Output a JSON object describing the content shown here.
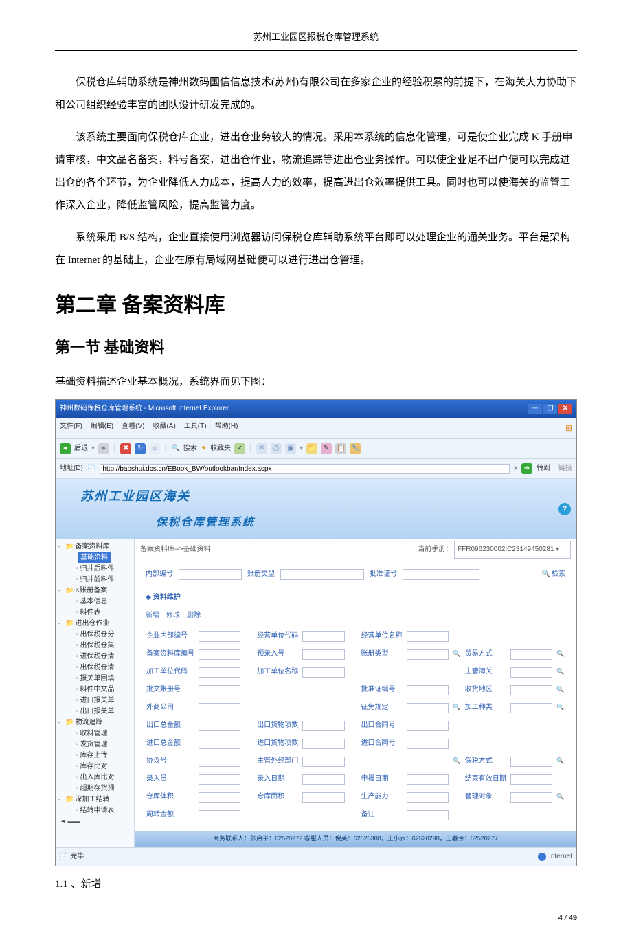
{
  "doc": {
    "page_header": "苏州工业园区报税仓库管理系统",
    "para1": "保税仓库辅助系统是神州数码国信信息技术(苏州)有限公司在多家企业的经验积累的前提下，在海关大力协助下和公司组织经验丰富的团队设计研发完成的。",
    "para2": "该系统主要面向保税仓库企业，进出仓业务较大的情况。采用本系统的信息化管理，可是使企业完成 K 手册申请审核，中文品名备案，料号备案，进出仓作业，物流追踪等进出仓业务操作。可以使企业足不出户便可以完成进出仓的各个环节，为企业降低人力成本，提高人力的效率，提高进出仓效率提供工具。同时也可以使海关的监管工作深入企业，降低监管风险，提高监管力度。",
    "para3": "系统采用 B/S 结构，企业直接使用浏览器访问保税仓库辅助系统平台即可以处理企业的通关业务。平台是架构在 Internet 的基础上，企业在原有局域网基础便可以进行进出仓管理。",
    "chapter": "第二章  备案资料库",
    "section": "第一节  基础资料",
    "intro": "基础资料描述企业基本概况，系统界面见下图：",
    "subhead": "1.1 、新增",
    "pagenum": "4 / 49"
  },
  "shot": {
    "title": "神州数码保税仓库管理系统 - Microsoft Internet Explorer",
    "menus": [
      "文件(F)",
      "编辑(E)",
      "查看(V)",
      "收藏(A)",
      "工具(T)",
      "帮助(H)"
    ],
    "tb": {
      "back": "后退",
      "search": "搜索",
      "fav": "收藏夹"
    },
    "addr_label": "地址(D)",
    "url": "http://baoshui.dcs.cn/EBook_BW/outlookbar/Index.aspx",
    "go": "转到",
    "links": "链接",
    "banner1": "苏州工业园区海关",
    "banner2": "保税仓库管理系统",
    "tree": [
      {
        "lv": 1,
        "exp": "-",
        "ic": "fld",
        "t": "备案资料库"
      },
      {
        "lv": 2,
        "exp": "",
        "ic": "sel",
        "t": "基础资料"
      },
      {
        "lv": 2,
        "exp": "",
        "ic": "pg",
        "t": "归并后料件"
      },
      {
        "lv": 2,
        "exp": "",
        "ic": "pg",
        "t": "归并前料件"
      },
      {
        "lv": 1,
        "exp": "-",
        "ic": "fld",
        "t": "K账册备案"
      },
      {
        "lv": 2,
        "exp": "",
        "ic": "pg",
        "t": "基本信息"
      },
      {
        "lv": 2,
        "exp": "",
        "ic": "pg",
        "t": "料件表"
      },
      {
        "lv": 1,
        "exp": "-",
        "ic": "fld",
        "t": "进出仓作业"
      },
      {
        "lv": 2,
        "exp": "",
        "ic": "pg",
        "t": "出保税仓分"
      },
      {
        "lv": 2,
        "exp": "",
        "ic": "pg",
        "t": "出保税仓集"
      },
      {
        "lv": 2,
        "exp": "",
        "ic": "pg",
        "t": "进保税仓清"
      },
      {
        "lv": 2,
        "exp": "",
        "ic": "pg",
        "t": "出保税仓清"
      },
      {
        "lv": 2,
        "exp": "",
        "ic": "pg",
        "t": "报关单回填"
      },
      {
        "lv": 2,
        "exp": "",
        "ic": "pg",
        "t": "料件中文品"
      },
      {
        "lv": 2,
        "exp": "",
        "ic": "pg",
        "t": "进口报关单"
      },
      {
        "lv": 2,
        "exp": "",
        "ic": "pg",
        "t": "出口报关单"
      },
      {
        "lv": 1,
        "exp": "-",
        "ic": "fld",
        "t": "物流追踪"
      },
      {
        "lv": 2,
        "exp": "",
        "ic": "pg",
        "t": "收料管理"
      },
      {
        "lv": 2,
        "exp": "",
        "ic": "pg",
        "t": "发货管理"
      },
      {
        "lv": 2,
        "exp": "",
        "ic": "pg",
        "t": "库存上传"
      },
      {
        "lv": 2,
        "exp": "",
        "ic": "pg",
        "t": "库存比对"
      },
      {
        "lv": 2,
        "exp": "",
        "ic": "pg",
        "t": "出入库比对"
      },
      {
        "lv": 2,
        "exp": "",
        "ic": "pg",
        "t": "超期存货预"
      },
      {
        "lv": 1,
        "exp": "-",
        "ic": "fld",
        "t": "深加工结转"
      },
      {
        "lv": 2,
        "exp": "",
        "ic": "pg",
        "t": "结转申请表"
      }
    ],
    "crumb": "备案资料库-->基础资料",
    "cur_label": "当前手册：",
    "cur_value": "FFR096230002|C23149450281",
    "search": {
      "f1": "内部编号",
      "f2": "账册类型",
      "f3": "批准证号",
      "btn": "检索"
    },
    "sect": "资料维护",
    "ops": {
      "add": "新增",
      "edit": "修改",
      "del": "删除"
    },
    "form_rows": [
      [
        {
          "l": "企业内部编号",
          "m": 0
        },
        {
          "l": "经营单位代码",
          "m": 0
        },
        {
          "l": "经营单位名称",
          "m": 0
        },
        {
          "l": "",
          "m": 0
        }
      ],
      [
        {
          "l": "备案资料库编号",
          "m": 0
        },
        {
          "l": "预录入号",
          "m": 0
        },
        {
          "l": "账册类型",
          "m": 1
        },
        {
          "l": "贸易方式",
          "m": 1
        }
      ],
      [
        {
          "l": "加工单位代码",
          "m": 0
        },
        {
          "l": "加工单位名称",
          "m": 0
        },
        {
          "l": "",
          "m": 0
        },
        {
          "l": "主管海关",
          "m": 1
        }
      ],
      [
        {
          "l": "批文账册号",
          "m": 0
        },
        {
          "l": "",
          "m": 0
        },
        {
          "l": "批准证编号",
          "m": 0
        },
        {
          "l": "收货地区",
          "m": 1
        }
      ],
      [
        {
          "l": "外商公司",
          "m": 0
        },
        {
          "l": "",
          "m": 0
        },
        {
          "l": "征免规定",
          "m": 1
        },
        {
          "l": "加工种类",
          "m": 1
        }
      ],
      [
        {
          "l": "出口总金额",
          "m": 0
        },
        {
          "l": "出口货物项数",
          "m": 0
        },
        {
          "l": "出口合同号",
          "m": 0
        },
        {
          "l": "",
          "m": 0
        }
      ],
      [
        {
          "l": "进口总金额",
          "m": 0
        },
        {
          "l": "进口货物项数",
          "m": 0
        },
        {
          "l": "进口合同号",
          "m": 0
        },
        {
          "l": "",
          "m": 0
        }
      ],
      [
        {
          "l": "协议号",
          "m": 0
        },
        {
          "l": "主管外经部门",
          "m": 0
        },
        {
          "l": "",
          "m": 1
        },
        {
          "l": "保税方式",
          "m": 1
        }
      ],
      [
        {
          "l": "录入员",
          "m": 0
        },
        {
          "l": "录入日期",
          "m": 0
        },
        {
          "l": "申报日期",
          "m": 0
        },
        {
          "l": "结束有效日期",
          "m": 0
        }
      ],
      [
        {
          "l": "仓库体积",
          "m": 0
        },
        {
          "l": "仓库面积",
          "m": 0
        },
        {
          "l": "生产能力",
          "m": 0
        },
        {
          "l": "管理对象",
          "m": 1
        }
      ],
      [
        {
          "l": "周转金额",
          "m": 0
        },
        {
          "l": "",
          "m": 0
        },
        {
          "l": "备注",
          "m": 0
        },
        {
          "l": "",
          "m": 0
        }
      ]
    ],
    "footer": "商务联系人：张启平：62520272 客服人员：倪英：62525308，王小云：62520290，王春芳：62520277",
    "status_done": "完毕",
    "status_net": "Internet"
  }
}
